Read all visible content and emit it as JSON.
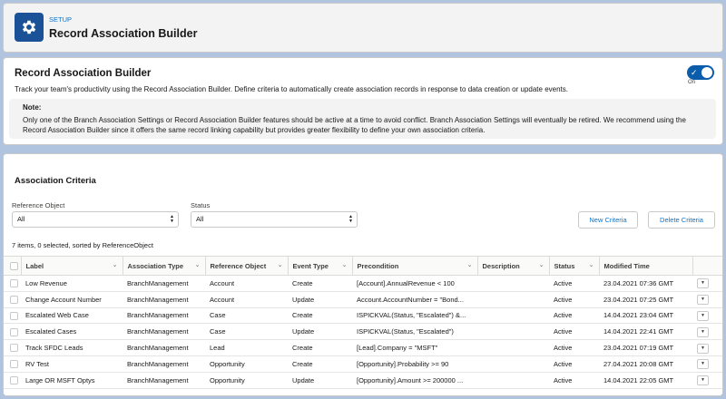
{
  "header": {
    "eyebrow": "SETUP",
    "title": "Record Association Builder",
    "icon": "gear-icon",
    "icon_bg": "#1b5297"
  },
  "intro": {
    "title": "Record Association Builder",
    "description": "Track your team's productivity using the Record Association Builder. Define criteria to automatically create association records in response to data creation or update events.",
    "toggle_state": "On",
    "note_title": "Note:",
    "note_text": "Only one of the Branch Association Settings or Record Association Builder features should be active at a time to avoid conflict. Branch Association Settings will eventually be retired. We recommend using the Record Association Builder since it offers the same record linking capability but provides greater flexibility to define your own association criteria."
  },
  "criteria": {
    "title": "Association Criteria",
    "filters": {
      "reference_object_label": "Reference Object",
      "reference_object_value": "All",
      "status_label": "Status",
      "status_value": "All"
    },
    "buttons": {
      "new": "New Criteria",
      "delete": "Delete Criteria"
    },
    "summary": "7 items, 0 selected, sorted by ReferenceObject",
    "columns": [
      "Label",
      "Association Type",
      "Reference Object",
      "Event Type",
      "Precondition",
      "Description",
      "Status",
      "Modified Time"
    ],
    "rows": [
      [
        "Low Revenue",
        "BranchManagement",
        "Account",
        "Create",
        "[Account].AnnualRevenue < 100",
        "",
        "Active",
        "23.04.2021 07:36 GMT"
      ],
      [
        "Change Account Number",
        "BranchManagement",
        "Account",
        "Update",
        "Account.AccountNumber = \"Bond...",
        "",
        "Active",
        "23.04.2021 07:25 GMT"
      ],
      [
        "Escalated Web Case",
        "BranchManagement",
        "Case",
        "Create",
        "ISPICKVAL(Status, \"Escalated\") &...",
        "",
        "Active",
        "14.04.2021 23:04 GMT"
      ],
      [
        "Escalated Cases",
        "BranchManagement",
        "Case",
        "Update",
        "ISPICKVAL(Status, \"Escalated\")",
        "",
        "Active",
        "14.04.2021 22:41 GMT"
      ],
      [
        "Track SFDC Leads",
        "BranchManagement",
        "Lead",
        "Create",
        "[Lead].Company = \"MSFT\"",
        "",
        "Active",
        "23.04.2021 07:19 GMT"
      ],
      [
        "RV Test",
        "BranchManagement",
        "Opportunity",
        "Create",
        "[Opportunity].Probability >= 90",
        "",
        "Active",
        "27.04.2021 20:08 GMT"
      ],
      [
        "Large OR MSFT Optys",
        "BranchManagement",
        "Opportunity",
        "Update",
        "[Opportunity].Amount >= 200000 ...",
        "",
        "Active",
        "14.04.2021 22:05 GMT"
      ]
    ]
  }
}
